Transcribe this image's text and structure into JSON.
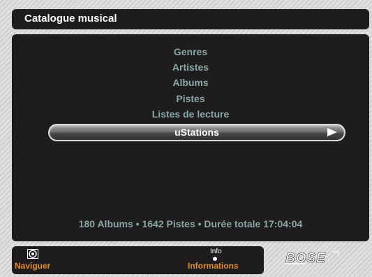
{
  "header": {
    "title": "Catalogue musical"
  },
  "menu": {
    "items": [
      {
        "label": "Genres"
      },
      {
        "label": "Artistes"
      },
      {
        "label": "Albums"
      },
      {
        "label": "Pistes"
      },
      {
        "label": "Listes de lecture"
      },
      {
        "label": "uStations",
        "selected": true
      }
    ]
  },
  "summary": "180 Albums • 1642 Pistes • Durée totale 17:04:04",
  "bottom": {
    "navigate_label": "Naviguer",
    "navigate_icon": "navigate-icon",
    "info_key": "Info",
    "info_label": "Informations"
  },
  "brand": {
    "logo_text": "BOSE",
    "logo_name": "bose-logo"
  },
  "colors": {
    "panel": "#1e1c1c",
    "menu_text": "#8aa7a8",
    "selected_text": "#ffffff",
    "footer_label": "#e88a2a",
    "background": "#d8d8d8"
  }
}
